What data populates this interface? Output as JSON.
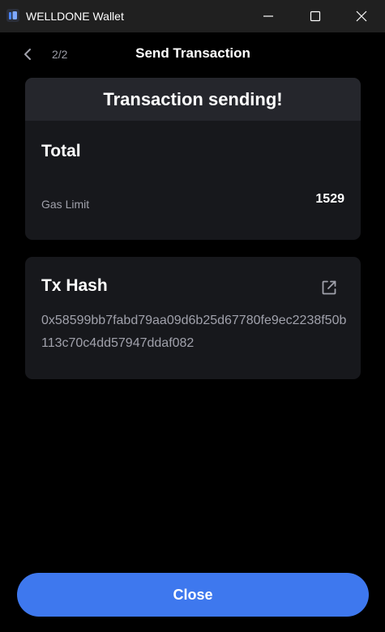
{
  "window": {
    "title": "WELLDONE Wallet",
    "icons": [
      "app-logo-icon",
      "minimize-icon",
      "maximize-icon",
      "close-icon"
    ]
  },
  "header": {
    "back_icon": "chevron-left-icon",
    "step": "2/2",
    "title": "Send Transaction"
  },
  "status_card": {
    "status": "Transaction sending!",
    "total_label": "Total",
    "gas_limit_label": "Gas Limit",
    "gas_limit_value": "1529"
  },
  "hash_card": {
    "title": "Tx Hash",
    "link_icon": "external-link-icon",
    "hash": "0x58599bb7fabd79aa09d6b25d67780fe9ec2238f50b113c70c4dd57947ddaf082"
  },
  "footer": {
    "close_label": "Close"
  },
  "colors": {
    "background": "#000000",
    "titlebar": "#202020",
    "card": "#17181c",
    "card_header": "#25262c",
    "muted_text": "#a0a1ab",
    "accent": "#3e78ee"
  }
}
